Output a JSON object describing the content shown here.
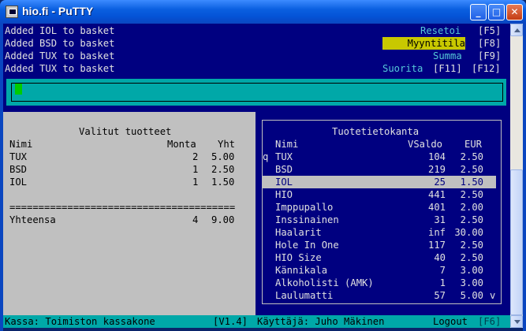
{
  "window": {
    "title": "hio.fi - PuTTY",
    "min_glyph": "_",
    "max_glyph": "□",
    "close_glyph": "✕"
  },
  "log": [
    "Added IOL to basket",
    "Added BSD to basket",
    "Added TUX to basket",
    "Added TUX to basket"
  ],
  "menu": {
    "reset_label": "Resetoi",
    "reset_key": "[F5]",
    "mode_label": "Myyntitila",
    "mode_key": "[F8]",
    "sum_label": "Summa",
    "sum_key": "[F9]",
    "execute_label": "Suorita",
    "execute_key": "[F11]",
    "extra_key": "[F12]"
  },
  "selected": {
    "title": "Valitut tuotteet",
    "col_name": "Nimi",
    "col_qty": "Monta",
    "col_total": "Yht",
    "rows": [
      {
        "name": "TUX",
        "qty": "2",
        "total": "5.00"
      },
      {
        "name": "BSD",
        "qty": "1",
        "total": "2.50"
      },
      {
        "name": "IOL",
        "qty": "1",
        "total": "1.50"
      }
    ],
    "separator": "=======================================",
    "sum_label": "Yhteensa",
    "sum_qty": "4",
    "sum_total": "9.00"
  },
  "database": {
    "title": "Tuotetietokanta",
    "col_name": "Nimi",
    "col_stock": "VSaldo",
    "col_price": "EUR",
    "scroll_up_marker": "q",
    "scroll_down_marker": "v",
    "selected_index": 2,
    "rows": [
      {
        "name": "TUX",
        "stock": "104",
        "price": "2.50"
      },
      {
        "name": "BSD",
        "stock": "219",
        "price": "2.50"
      },
      {
        "name": "IOL",
        "stock": "25",
        "price": "1.50"
      },
      {
        "name": "HIO",
        "stock": "441",
        "price": "2.50"
      },
      {
        "name": "Imppupallo",
        "stock": "401",
        "price": "2.00"
      },
      {
        "name": "Inssinainen",
        "stock": "31",
        "price": "2.50"
      },
      {
        "name": "Haalarit",
        "stock": "inf",
        "price": "30.00"
      },
      {
        "name": "Hole In One",
        "stock": "117",
        "price": "2.50"
      },
      {
        "name": "HIO Size",
        "stock": "40",
        "price": "2.50"
      },
      {
        "name": "Kännikala",
        "stock": "7",
        "price": "3.00"
      },
      {
        "name": "Alkoholisti (AMK)",
        "stock": "1",
        "price": "3.00"
      },
      {
        "name": "Laulumatti",
        "stock": "57",
        "price": "5.00"
      }
    ]
  },
  "status": {
    "register": "Kassa: Toimiston kassakone",
    "version": "[V1.4]",
    "user": "Käyttäjä: Juho Mäkinen",
    "logout_label": "Logout",
    "logout_key": "[F6]"
  },
  "colors": {
    "terminal_bg": "#000080",
    "panel_grey": "#c0c0c0",
    "teal": "#00a8a8",
    "highlight_yellow": "#c8c800",
    "cursor_green": "#00cc00"
  }
}
